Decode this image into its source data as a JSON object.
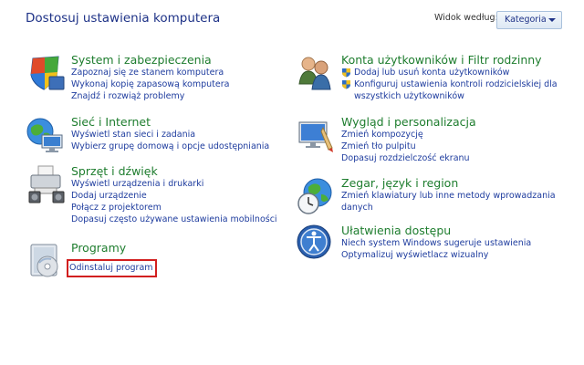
{
  "header": {
    "title": "Dostosuj ustawienia komputera",
    "view_by_label": "Widok według:",
    "view_by_value": "Kategoria"
  },
  "left_column": [
    {
      "title": "System i zabezpieczenia",
      "icon": "system-security-icon",
      "links": [
        "Zapoznaj się ze stanem komputera",
        "Wykonaj kopię zapasową komputera",
        "Znajdź i rozwiąż problemy"
      ]
    },
    {
      "title": "Sieć i Internet",
      "icon": "network-internet-icon",
      "links": [
        "Wyświetl stan sieci i zadania",
        "Wybierz grupę domową i opcje udostępniania"
      ]
    },
    {
      "title": "Sprzęt i dźwięk",
      "icon": "hardware-sound-icon",
      "links": [
        "Wyświetl urządzenia i drukarki",
        "Dodaj urządzenie",
        "Połącz z projektorem",
        "Dopasuj często używane ustawienia mobilności"
      ]
    },
    {
      "title": "Programy",
      "icon": "programs-icon",
      "links": [
        "Odinstaluj program"
      ]
    }
  ],
  "right_column": [
    {
      "title": "Konta użytkowników i Filtr rodzinny",
      "icon": "user-accounts-icon",
      "links": [
        "Dodaj lub usuń konta użytkowników",
        "Konfiguruj ustawienia kontroli rodzicielskiej dla",
        "wszystkich użytkowników"
      ]
    },
    {
      "title": "Wygląd i personalizacja",
      "icon": "appearance-icon",
      "links": [
        "Zmień kompozycję",
        "Zmień tło pulpitu",
        "Dopasuj rozdzielczość ekranu"
      ]
    },
    {
      "title": "Zegar, język i region",
      "icon": "clock-region-icon",
      "links": [
        "Zmień klawiatury lub inne metody wprowadzania",
        "danych"
      ]
    },
    {
      "title": "Ułatwienia dostępu",
      "icon": "ease-of-access-icon",
      "links": [
        "Niech system Windows sugeruje ustawienia",
        "Optymalizuj wyświetlacz wizualny"
      ]
    }
  ],
  "colors": {
    "title_blue": "#1e3287",
    "category_green": "#1e7d2e",
    "link_blue": "#1e3c9e",
    "highlight_red": "#d21f1f"
  }
}
